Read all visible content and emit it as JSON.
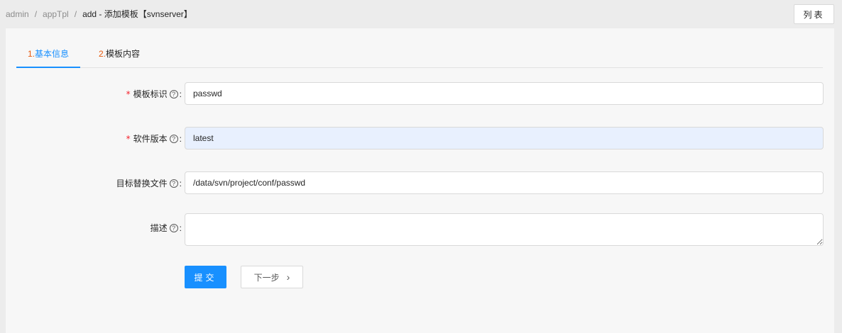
{
  "breadcrumb": {
    "items": [
      "admin",
      "appTpl"
    ],
    "separator": "/",
    "current": "add - 添加模板【svnserver】"
  },
  "header": {
    "list_button": "列表"
  },
  "tabs": [
    {
      "num": "1.",
      "label": "基本信息",
      "active": true
    },
    {
      "num": "2.",
      "label": "模板内容",
      "active": false
    }
  ],
  "form": {
    "fields": [
      {
        "label": "模板标识",
        "required": true,
        "value": "passwd"
      },
      {
        "label": "软件版本",
        "required": true,
        "value": "latest"
      },
      {
        "label": "目标替换文件",
        "required": false,
        "value": "/data/svn/project/conf/passwd"
      },
      {
        "label": "描述",
        "required": false,
        "value": ""
      }
    ],
    "required_mark": "*",
    "help_icon": "?",
    "colon": ":",
    "submit_label": "提交",
    "next_label": "下一步",
    "next_icon": "›"
  },
  "colors": {
    "accent": "#1890ff",
    "tab_number": "#e8590c",
    "required": "#f5222d",
    "autofill": "#e8f0fe"
  }
}
